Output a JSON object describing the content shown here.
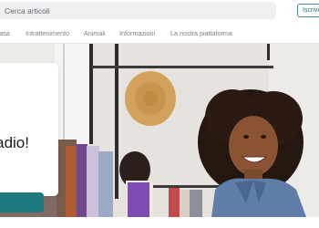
{
  "header": {
    "search_placeholder": "Cerca articoli",
    "signup_label": "Iscriviti"
  },
  "nav": {
    "categories": [
      "Casa",
      "Intrattenimento",
      "Animali",
      "Informazioni",
      "La nostra piattaforma"
    ]
  },
  "hero": {
    "title": "adio!",
    "cta_label": ""
  },
  "colors": {
    "accent": "#1d7a7f",
    "search_bg": "#f0f0f0"
  }
}
